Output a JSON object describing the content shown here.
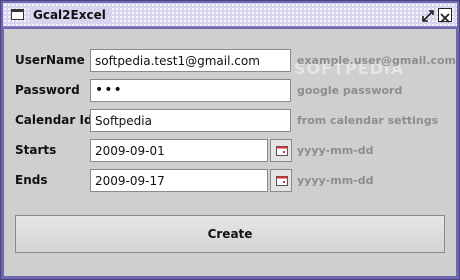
{
  "window": {
    "title": "Gcal2Excel",
    "icons": {
      "app": "window-icon",
      "restore": "restore-icon",
      "close": "close-icon"
    }
  },
  "form": {
    "username": {
      "label": "UserName",
      "value": "softpedia.test1@gmail.com",
      "hint": "example.user@gmail.com"
    },
    "password": {
      "label": "Password",
      "value": "•••",
      "hint": "google password"
    },
    "calendar_id": {
      "label": "Calendar Id",
      "value": "Softpedia",
      "hint": "from calendar settings"
    },
    "starts": {
      "label": "Starts",
      "value": "2009-09-01",
      "hint": "yyyy-mm-dd"
    },
    "ends": {
      "label": "Ends",
      "value": "2009-09-17",
      "hint": "yyyy-mm-dd"
    }
  },
  "actions": {
    "create_label": "Create"
  },
  "watermark": "SOFTPEDIA",
  "colors": {
    "frame": "#6f68b0",
    "titlebar": "#d6d4ee",
    "panel": "#cfcfcf",
    "hint_text": "#8d8d8d"
  }
}
